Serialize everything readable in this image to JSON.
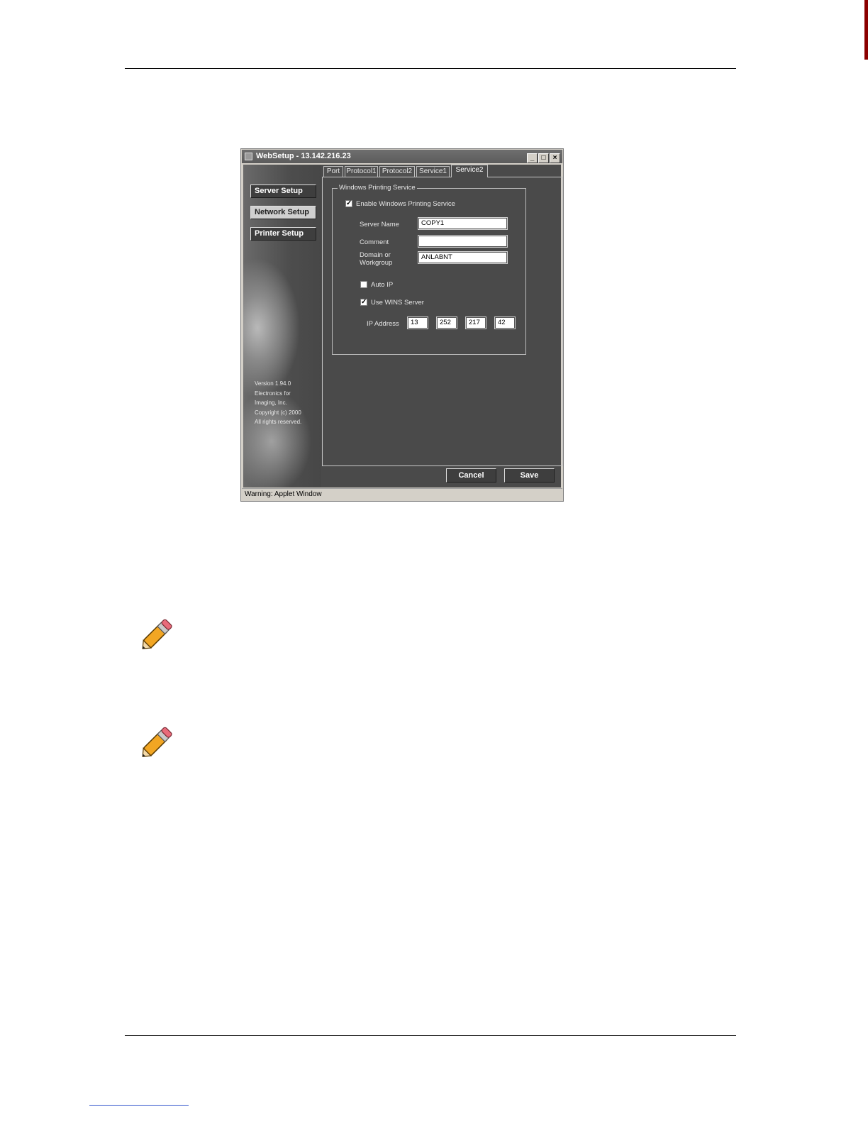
{
  "window": {
    "title": "WebSetup - 13.142.216.23",
    "title_buttons": [
      "_",
      "□",
      "×"
    ],
    "status_text": "Warning: Applet Window"
  },
  "sidebar": {
    "items": [
      {
        "label": "Server Setup",
        "active": false
      },
      {
        "label": "Network Setup",
        "active": true
      },
      {
        "label": "Printer Setup",
        "active": false
      }
    ],
    "version_lines": [
      "Version 1.94.0",
      "Electronics for",
      "Imaging, Inc.",
      "Copyright (c) 2000",
      "All rights reserved."
    ]
  },
  "tabs": [
    {
      "label": "Port",
      "active": false
    },
    {
      "label": "Protocol1",
      "active": false
    },
    {
      "label": "Protocol2",
      "active": false
    },
    {
      "label": "Service1",
      "active": false
    },
    {
      "label": "Service2",
      "active": true
    }
  ],
  "windows_printing": {
    "group_title": "Windows Printing Service",
    "enable_label": "Enable Windows Printing Service",
    "enable_checked": true,
    "server_name_label": "Server Name",
    "server_name_value": "COPY1",
    "comment_label": "Comment",
    "comment_value": "",
    "domain_label_line1": "Domain or",
    "domain_label_line2": "Workgroup",
    "domain_value": "ANLABNT",
    "auto_ip_label": "Auto IP",
    "auto_ip_checked": false,
    "wins_label": "Use WINS Server",
    "wins_checked": true,
    "ip_label": "IP Address",
    "ip_octets": [
      "13",
      "252",
      "217",
      "42"
    ]
  },
  "buttons": {
    "cancel": "Cancel",
    "save": "Save"
  },
  "colors": {
    "panel": "#4a4a4a",
    "edge_bar": "#8b0000",
    "footer_link_line": "#3355cc"
  },
  "notes": [
    {
      "icon": "pencil-note-icon"
    },
    {
      "icon": "pencil-note-icon"
    }
  ]
}
